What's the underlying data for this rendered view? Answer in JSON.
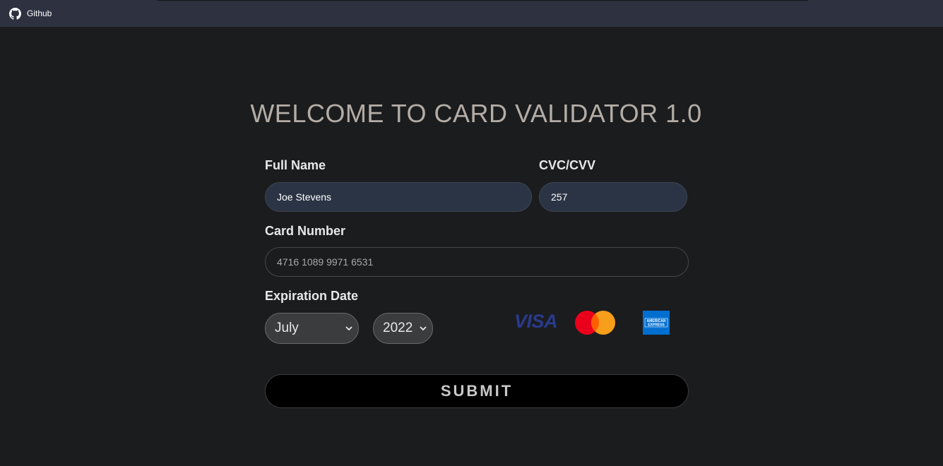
{
  "nav": {
    "github_label": "Github"
  },
  "page": {
    "title": "WELCOME TO CARD VALIDATOR 1.0"
  },
  "form": {
    "full_name_label": "Full Name",
    "full_name_value": "Joe Stevens",
    "cvc_label": "CVC/CVV",
    "cvc_value": "257",
    "card_number_label": "Card Number",
    "card_number_placeholder": "4716 1089 9971 6531",
    "expiration_label": "Expiration Date",
    "month_selected": "July",
    "year_selected": "2022",
    "submit_label": "SUBMIT"
  },
  "brands": {
    "visa_label": "VISA",
    "amex_text_top": "AMERICAN",
    "amex_text_bottom": "EXPRESS"
  },
  "colors": {
    "background": "#1b1c1e",
    "topbar": "#2d3140",
    "title": "#b4ada6",
    "filled_input": "#2b3444",
    "mastercard_red": "#eb001b",
    "mastercard_orange": "#f79e1b",
    "amex_blue": "#016fd0",
    "visa_blue": "#2a3a8c"
  },
  "icons": {
    "github": "github-icon",
    "chevron": "chevron-down-icon",
    "visa": "visa-logo",
    "mastercard": "mastercard-logo",
    "amex": "amex-logo"
  }
}
